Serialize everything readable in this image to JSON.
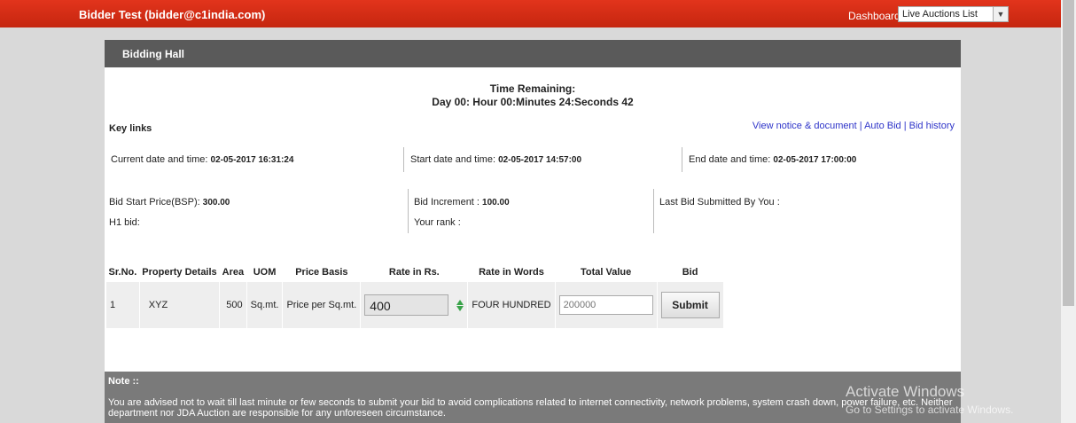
{
  "topbar": {
    "user": "Bidder Test (bidder@c1india.com)",
    "dashboard_label": "Dashboard",
    "auction_select_value": "Live Auctions List",
    "accent_color": "#d42e15"
  },
  "panel": {
    "title": "Bidding Hall"
  },
  "timer": {
    "label": "Time Remaining:",
    "value": "Day 00: Hour 00:Minutes 24:Seconds 42"
  },
  "key_links": {
    "label": "Key links",
    "links": [
      "View notice & document",
      "Auto Bid",
      "Bid history"
    ],
    "separator": " | "
  },
  "dates": {
    "current_label": "Current date and time:",
    "current_value": "02-05-2017 16:31:24",
    "start_label": "Start date and time:",
    "start_value": "02-05-2017 14:57:00",
    "end_label": "End date and time:",
    "end_value": "02-05-2017 17:00:00"
  },
  "bid_info": {
    "bsp_label": "Bid Start Price(BSP):",
    "bsp_value": "300.00",
    "increment_label": "Bid Increment :",
    "increment_value": "100.00",
    "last_bid_label": "Last Bid Submitted By You :",
    "h1_label": "H1 bid:",
    "rank_label": "Your rank :"
  },
  "table": {
    "headers": [
      "Sr.No.",
      "Property Details",
      "Area",
      "UOM",
      "Price Basis",
      "Rate in Rs.",
      "Rate in Words",
      "Total Value",
      "Bid"
    ],
    "rows": [
      {
        "sr_no": "1",
        "property": "XYZ",
        "area": "500",
        "uom": "Sq.mt.",
        "price_basis": "Price per Sq.mt.",
        "rate": "400",
        "rate_words": "FOUR HUNDRED",
        "total_placeholder": "200000",
        "submit_label": "Submit"
      }
    ]
  },
  "note": {
    "title": "Note ::",
    "text": "You are advised not to wait till last minute or few seconds to submit your bid to avoid complications related to internet connectivity, network problems, system crash down, power failure, etc. Neither department nor JDA Auction are responsible for any unforeseen circumstance."
  },
  "watermark": {
    "line1": "Activate Windows",
    "line2": "Go to Settings to activate Windows."
  }
}
